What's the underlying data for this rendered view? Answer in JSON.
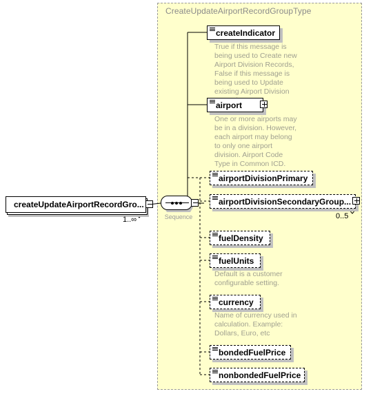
{
  "diagram": {
    "type": "xsd-schema-diagram",
    "background_color": "#ffffff",
    "group_fill_color": "#ffffcc",
    "group_border_color": "#999999",
    "annotation_text_color": "#a0a090",
    "title_text_color": "#8a8a8a"
  },
  "group": {
    "title": "CreateUpdateAirportRecordGroupType"
  },
  "root": {
    "label": "createUpdateAirportRecordGro...",
    "cardinality": "1..∞",
    "toggle": "minus"
  },
  "compositor": {
    "label": "Sequence",
    "icon": "sequence-icon",
    "toggle": "minus"
  },
  "children": [
    {
      "name": "createIndicator",
      "label": "createIndicator",
      "required": true,
      "toggle": null,
      "cardinality": null,
      "annotation": "True if this message is being used to Create new Airport Division Records, False if this message is being used to Update existing Airport Division Records."
    },
    {
      "name": "airport",
      "label": "airport",
      "required": true,
      "toggle": "plus",
      "cardinality": null,
      "annotation": "One or more airports may be in a division.  However, each airport may belong to only one airport division. Airport Code Type in Common ICD."
    },
    {
      "name": "airportDivisionPrimary",
      "label": "airportDivisionPrimary",
      "required": false,
      "toggle": null,
      "cardinality": null,
      "annotation": null
    },
    {
      "name": "airportDivisionSecondaryGroup",
      "label": "airportDivisionSecondaryGroup...",
      "required": false,
      "toggle": "plus",
      "cardinality": "0..5",
      "annotation": null
    },
    {
      "name": "fuelDensity",
      "label": "fuelDensity",
      "required": false,
      "toggle": null,
      "cardinality": null,
      "annotation": null
    },
    {
      "name": "fuelUnits",
      "label": "fuelUnits",
      "required": false,
      "toggle": null,
      "cardinality": null,
      "annotation": "Default is a customer configurable setting."
    },
    {
      "name": "currency",
      "label": "currency",
      "required": false,
      "toggle": null,
      "cardinality": null,
      "annotation": "Name of currency used in calculation.  Example: Dollars, Euro, etc"
    },
    {
      "name": "bondedFuelPrice",
      "label": "bondedFuelPrice",
      "required": false,
      "toggle": null,
      "cardinality": null,
      "annotation": null
    },
    {
      "name": "nonbondedFuelPrice",
      "label": "nonbondedFuelPrice",
      "required": false,
      "toggle": null,
      "cardinality": null,
      "annotation": null
    }
  ]
}
